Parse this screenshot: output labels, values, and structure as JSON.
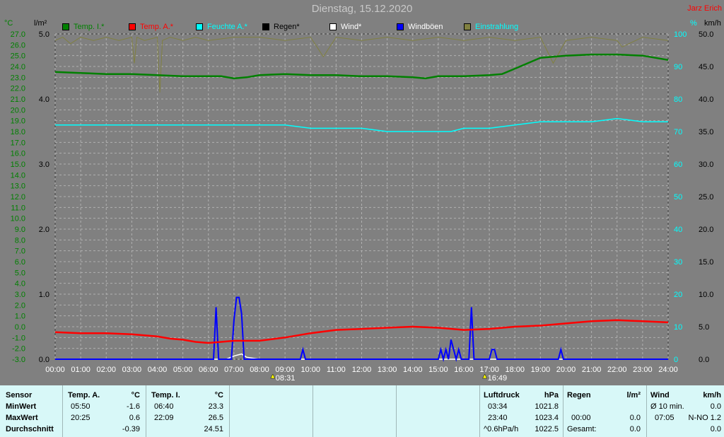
{
  "title": "Dienstag, 15.12.2020",
  "author": "Jarz Erich",
  "legend": [
    {
      "label": "Temp. I.*",
      "color": "#008000"
    },
    {
      "label": "Temp. A.*",
      "color": "#ff0000"
    },
    {
      "label": "Feuchte A.*",
      "color": "#00ffff"
    },
    {
      "label": "Regen*",
      "color": "#000000"
    },
    {
      "label": "Wind*",
      "color": "#ffffff"
    },
    {
      "label": "Windböen",
      "color": "#0000ff"
    },
    {
      "label": "Einstrahlung",
      "color": "#00ffff",
      "swatch": "#808040"
    }
  ],
  "units": {
    "temp": "°C",
    "rain": "l/m²",
    "humidity": "%",
    "wind": "km/h"
  },
  "chart_data": {
    "type": "line",
    "x_ticks": [
      "00:00",
      "01:00",
      "02:00",
      "03:00",
      "04:00",
      "05:00",
      "06:00",
      "07:00",
      "08:00",
      "09:00",
      "10:00",
      "11:00",
      "12:00",
      "13:00",
      "14:00",
      "15:00",
      "16:00",
      "17:00",
      "18:00",
      "19:00",
      "20:00",
      "21:00",
      "22:00",
      "23:00",
      "24:00"
    ],
    "sun_events": [
      {
        "label": "08:31",
        "x": 8.52
      },
      {
        "label": "16:49",
        "x": 16.82
      }
    ],
    "axes": {
      "temp": {
        "min": -3.0,
        "max": 27.0,
        "step": 1.0,
        "color": "#008000"
      },
      "rain": {
        "min": 0.0,
        "max": 5.0,
        "ticks": [
          0.0,
          1.0,
          2.0,
          3.0,
          4.0,
          5.0
        ],
        "color": "#000000"
      },
      "humidity": {
        "min": 0,
        "max": 100,
        "step": 10,
        "color": "#00ffff"
      },
      "wind": {
        "min": 0.0,
        "max": 50.0,
        "step": 5.0,
        "color": "#000000"
      }
    },
    "series": [
      {
        "name": "Temp. I.*",
        "axis": "temp",
        "color": "#008000",
        "x": [
          0,
          1,
          2,
          3,
          4,
          5,
          6,
          6.5,
          7,
          7.5,
          8,
          9,
          10,
          11,
          12,
          13,
          14,
          14.5,
          15,
          16,
          17,
          17.5,
          18,
          19,
          20,
          21,
          22,
          23,
          24
        ],
        "y": [
          23.5,
          23.4,
          23.3,
          23.3,
          23.2,
          23.1,
          23.1,
          23.1,
          22.9,
          23.0,
          23.2,
          23.3,
          23.2,
          23.2,
          23.1,
          23.1,
          23.0,
          22.9,
          23.1,
          23.1,
          23.2,
          23.3,
          23.8,
          24.8,
          25.0,
          25.1,
          25.1,
          25.0,
          24.6
        ]
      },
      {
        "name": "Temp. A.*",
        "axis": "temp",
        "color": "#ff0000",
        "x": [
          0,
          1,
          2,
          3,
          4,
          4.5,
          5,
          5.5,
          6,
          6.5,
          7,
          8,
          9,
          10,
          11,
          12,
          13,
          14,
          15,
          16,
          17,
          18,
          19,
          20,
          21,
          22,
          23,
          24
        ],
        "y": [
          -0.5,
          -0.6,
          -0.6,
          -0.7,
          -0.9,
          -1.1,
          -1.2,
          -1.4,
          -1.5,
          -1.4,
          -1.3,
          -1.3,
          -1.0,
          -0.6,
          -0.3,
          -0.2,
          -0.1,
          0.0,
          -0.1,
          -0.3,
          -0.2,
          0.0,
          0.1,
          0.3,
          0.5,
          0.6,
          0.5,
          0.4
        ]
      },
      {
        "name": "Feuchte A.*",
        "axis": "humidity",
        "color": "#00ffff",
        "x": [
          0,
          1,
          2,
          3,
          4,
          5,
          6,
          7,
          8,
          9,
          10,
          11,
          12,
          13,
          14,
          15,
          15.5,
          16,
          17,
          18,
          19,
          20,
          21,
          22,
          23,
          24
        ],
        "y": [
          72,
          72,
          72,
          72,
          72,
          72,
          72,
          72,
          72,
          72,
          71,
          71,
          71,
          70,
          70,
          70,
          70,
          71,
          71,
          72,
          73,
          73,
          73,
          74,
          73,
          73
        ]
      },
      {
        "name": "Windböen",
        "axis": "wind",
        "color": "#0000ff",
        "x": [
          0,
          6.2,
          6.3,
          6.4,
          6.5,
          6.6,
          6.9,
          7.0,
          7.1,
          7.2,
          7.3,
          7.4,
          7.5,
          7.6,
          9.6,
          9.7,
          9.8,
          15.0,
          15.1,
          15.2,
          15.3,
          15.4,
          15.5,
          15.7,
          15.8,
          15.9,
          16.2,
          16.3,
          16.4,
          16.5,
          16.6,
          17.0,
          17.1,
          17.2,
          17.3,
          19.7,
          19.8,
          19.9,
          24
        ],
        "y": [
          0,
          0,
          8,
          0,
          0,
          0,
          0,
          6,
          9.5,
          9.5,
          7,
          0,
          0,
          0,
          0,
          1.5,
          0,
          0,
          1.5,
          0,
          1.5,
          0,
          3,
          0,
          1.5,
          0,
          0,
          8,
          0,
          0,
          0,
          0,
          1.5,
          1.5,
          0,
          0,
          1.5,
          0,
          0
        ]
      },
      {
        "name": "Wind*",
        "axis": "wind",
        "color": "#ffffff",
        "x": [
          0,
          6.7,
          7.0,
          7.3,
          7.5,
          8,
          24
        ],
        "y": [
          0,
          0,
          0.5,
          0.8,
          0.3,
          0,
          0
        ]
      },
      {
        "name": "Einstrahlung",
        "axis": "humidity",
        "color": "#808040",
        "x": [
          0,
          0.3,
          0.6,
          1,
          1.5,
          2,
          2.5,
          3,
          3.1,
          3.2,
          3.5,
          4,
          4.1,
          4.2,
          4.5,
          5,
          5.5,
          6,
          7,
          8,
          9,
          10,
          10.5,
          11,
          12,
          13,
          14,
          15,
          16,
          17,
          18,
          19,
          19.5,
          20,
          21,
          22,
          22.2,
          23,
          24
        ],
        "y": [
          98,
          99,
          97,
          99,
          98,
          99,
          98,
          99,
          91,
          99,
          98,
          99,
          82,
          98,
          99,
          98,
          99,
          98,
          99,
          99,
          98,
          99,
          93,
          99,
          98,
          99,
          98,
          99,
          98,
          99,
          98,
          99,
          91,
          98,
          99,
          98,
          96,
          99,
          98
        ]
      }
    ]
  },
  "table": {
    "sensor_col": {
      "header": "Sensor",
      "rows": [
        "MinWert",
        "MaxWert",
        "Durchschnitt"
      ]
    },
    "temp_a": {
      "header": "Temp. A.",
      "unit": "°C",
      "times": [
        "05:50",
        "20:25",
        ""
      ],
      "values": [
        "-1.6",
        "0.6",
        "-0.39"
      ]
    },
    "temp_i": {
      "header": "Temp. I.",
      "unit": "°C",
      "times": [
        "06:40",
        "22:09",
        ""
      ],
      "values": [
        "23.3",
        "26.5",
        "24.51"
      ]
    },
    "pressure": {
      "header": "Luftdruck",
      "unit": "hPa",
      "times": [
        "03:34",
        "23:40",
        "^0.6hPa/h"
      ],
      "values": [
        "1021.8",
        "1023.4",
        "1022.5"
      ]
    },
    "rain": {
      "header": "Regen",
      "unit": "l/m²",
      "times": [
        "",
        "00:00",
        "Gesamt:"
      ],
      "values": [
        "",
        "0.0",
        "0.0"
      ]
    },
    "wind": {
      "header": "Wind",
      "unit": "km/h",
      "times": [
        "Ø 10 min.",
        "07:05",
        ""
      ],
      "values": [
        "0.0",
        "N-NO 1.2",
        "0.0"
      ]
    }
  }
}
